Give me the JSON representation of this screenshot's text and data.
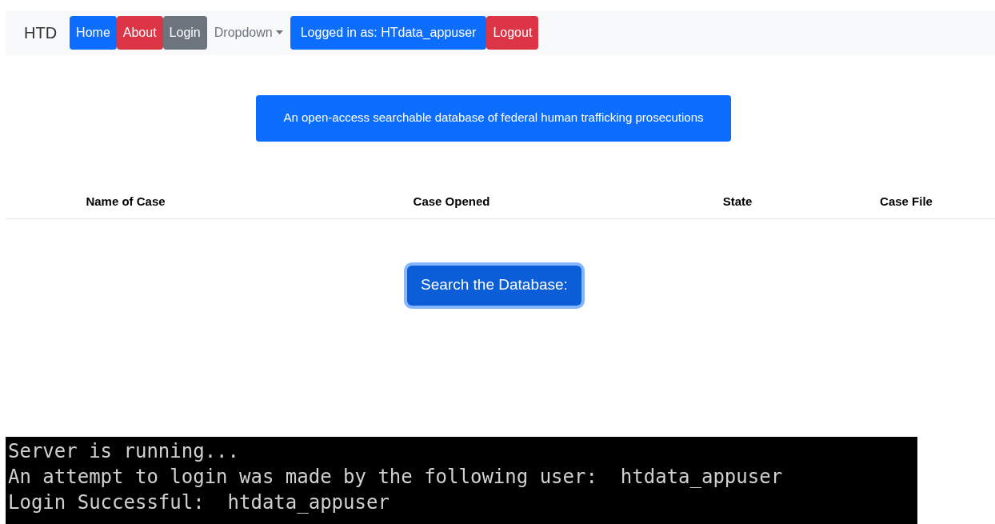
{
  "navbar": {
    "brand": "HTD",
    "items": [
      {
        "label": "Home",
        "kind": "button",
        "color": "#0d6efd"
      },
      {
        "label": "About",
        "kind": "button",
        "color": "#dc3545"
      },
      {
        "label": "Login",
        "kind": "button",
        "color": "#6c757d"
      },
      {
        "label": "Dropdown",
        "kind": "dropdown"
      },
      {
        "label": "Logged in as: HTdata_appuser",
        "kind": "button",
        "color": "#0d6efd"
      },
      {
        "label": "Logout",
        "kind": "button",
        "color": "#dc3545"
      }
    ]
  },
  "banner": "An open-access searchable database of federal human trafficking prosecutions",
  "table": {
    "columns": [
      "Name of Case",
      "Case Opened",
      "State",
      "Case File"
    ]
  },
  "search_button": {
    "label": "Search the Database:",
    "focused": true
  },
  "console": {
    "lines": [
      "Server is running...",
      "An attempt to login was made by the following user:  htdata_appuser",
      "Login Successful:  htdata_appuser"
    ]
  }
}
